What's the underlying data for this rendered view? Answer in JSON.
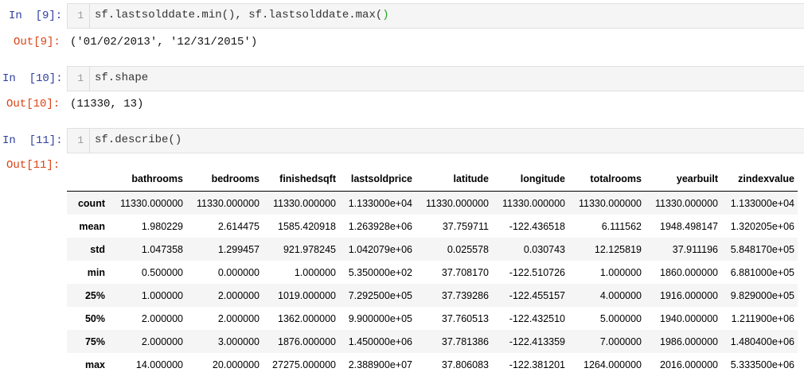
{
  "cells": [
    {
      "in_prompt": "In  [9]:",
      "line_number": "1",
      "code_main": "sf.lastsolddate.min(), sf.lastsolddate.max(",
      "code_paren": ")",
      "out_prompt": "Out[9]:",
      "output": "('01/02/2013', '12/31/2015')"
    },
    {
      "in_prompt": "In  [10]:",
      "line_number": "1",
      "code": "sf.shape",
      "out_prompt": "Out[10]:",
      "output": "(11330, 13)"
    },
    {
      "in_prompt": "In  [11]:",
      "line_number": "1",
      "code": "sf.describe()",
      "out_prompt": "Out[11]:"
    }
  ],
  "describe_table": {
    "columns": [
      "",
      "bathrooms",
      "bedrooms",
      "finishedsqft",
      "lastsoldprice",
      "latitude",
      "longitude",
      "totalrooms",
      "yearbuilt",
      "zindexvalue"
    ],
    "rows": [
      {
        "label": "count",
        "values": [
          "11330.000000",
          "11330.000000",
          "11330.000000",
          "1.133000e+04",
          "11330.000000",
          "11330.000000",
          "11330.000000",
          "11330.000000",
          "1.133000e+04"
        ]
      },
      {
        "label": "mean",
        "values": [
          "1.980229",
          "2.614475",
          "1585.420918",
          "1.263928e+06",
          "37.759711",
          "-122.436518",
          "6.111562",
          "1948.498147",
          "1.320205e+06"
        ]
      },
      {
        "label": "std",
        "values": [
          "1.047358",
          "1.299457",
          "921.978245",
          "1.042079e+06",
          "0.025578",
          "0.030743",
          "12.125819",
          "37.911196",
          "5.848170e+05"
        ]
      },
      {
        "label": "min",
        "values": [
          "0.500000",
          "0.000000",
          "1.000000",
          "5.350000e+02",
          "37.708170",
          "-122.510726",
          "1.000000",
          "1860.000000",
          "6.881000e+05"
        ]
      },
      {
        "label": "25%",
        "values": [
          "1.000000",
          "2.000000",
          "1019.000000",
          "7.292500e+05",
          "37.739286",
          "-122.455157",
          "4.000000",
          "1916.000000",
          "9.829000e+05"
        ]
      },
      {
        "label": "50%",
        "values": [
          "2.000000",
          "2.000000",
          "1362.000000",
          "9.900000e+05",
          "37.760513",
          "-122.432510",
          "5.000000",
          "1940.000000",
          "1.211900e+06"
        ]
      },
      {
        "label": "75%",
        "values": [
          "2.000000",
          "3.000000",
          "1876.000000",
          "1.450000e+06",
          "37.781386",
          "-122.413359",
          "7.000000",
          "1986.000000",
          "1.480400e+06"
        ]
      },
      {
        "label": "max",
        "values": [
          "14.000000",
          "20.000000",
          "27275.000000",
          "2.388900e+07",
          "37.806083",
          "-122.381201",
          "1264.000000",
          "2016.000000",
          "5.333500e+06"
        ]
      }
    ]
  }
}
